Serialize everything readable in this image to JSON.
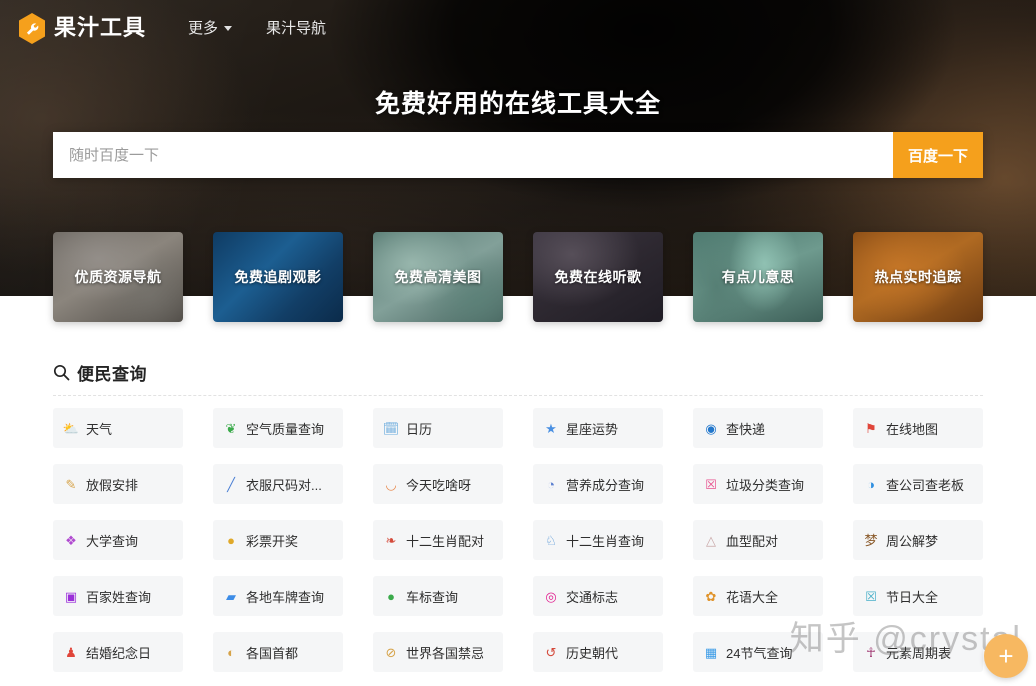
{
  "nav": {
    "brand": "果汁工具",
    "logo_icon": "wrench-hexagon-icon",
    "brand_color": "#f5a01c",
    "links": [
      {
        "label": "更多",
        "has_caret": true
      },
      {
        "label": "果汁导航",
        "has_caret": false
      }
    ]
  },
  "hero": {
    "title": "免费好用的在线工具大全",
    "search": {
      "placeholder": "随时百度一下",
      "value": "",
      "button_label": "百度一下",
      "button_color": "#f5a01c"
    }
  },
  "cards": [
    {
      "label": "优质资源导航"
    },
    {
      "label": "免费追剧观影"
    },
    {
      "label": "免费高清美图"
    },
    {
      "label": "免费在线听歌"
    },
    {
      "label": "有点儿意思"
    },
    {
      "label": "热点实时追踪"
    }
  ],
  "section": {
    "icon": "search-icon",
    "title": "便民查询",
    "items": [
      {
        "label": "天气",
        "icon": "sun-cloud-icon",
        "color": "#3c8ce7"
      },
      {
        "label": "空气质量查询",
        "icon": "leaf-icon",
        "color": "#3aaa4a"
      },
      {
        "label": "日历",
        "icon": "calendar-icon",
        "color": "#67a9dd"
      },
      {
        "label": "星座运势",
        "icon": "star-icon",
        "color": "#4a90e2"
      },
      {
        "label": "查快递",
        "icon": "delivery-truck-icon",
        "color": "#2277cc"
      },
      {
        "label": "在线地图",
        "icon": "map-pin-icon",
        "color": "#e0453a"
      },
      {
        "label": "放假安排",
        "icon": "note-pencil-icon",
        "color": "#d6a349"
      },
      {
        "label": "衣服尺码对...",
        "icon": "ruler-icon",
        "color": "#4a7fd4"
      },
      {
        "label": "今天吃啥呀",
        "icon": "noodle-bowl-icon",
        "color": "#e8874a"
      },
      {
        "label": "营养成分查询",
        "icon": "nutrition-icon",
        "color": "#5a7fd0"
      },
      {
        "label": "垃圾分类查询",
        "icon": "trash-bin-icon",
        "color": "#e8538f"
      },
      {
        "label": "查公司查老板",
        "icon": "globe-search-icon",
        "color": "#2f8fe0"
      },
      {
        "label": "大学查询",
        "icon": "diamond-icon",
        "color": "#b04ad0"
      },
      {
        "label": "彩票开奖",
        "icon": "lottery-coin-icon",
        "color": "#e0a92a"
      },
      {
        "label": "十二生肖配对",
        "icon": "rooster-icon",
        "color": "#d44a3a"
      },
      {
        "label": "十二生肖查询",
        "icon": "horse-icon",
        "color": "#4a8fd4"
      },
      {
        "label": "血型配对",
        "icon": "blood-drop-icon",
        "color": "#c9a8a8"
      },
      {
        "label": "周公解梦",
        "icon": "dream-char-icon",
        "color": "#8a5a2a"
      },
      {
        "label": "百家姓查询",
        "icon": "surname-book-icon",
        "color": "#9b30d9"
      },
      {
        "label": "各地车牌查询",
        "icon": "car-icon",
        "color": "#3c8ce7"
      },
      {
        "label": "车标查询",
        "icon": "car-badge-icon",
        "color": "#3aaa4a"
      },
      {
        "label": "交通标志",
        "icon": "traffic-light-icon",
        "color": "#e01f8f"
      },
      {
        "label": "花语大全",
        "icon": "sunflower-icon",
        "color": "#e0932a"
      },
      {
        "label": "节日大全",
        "icon": "gift-icon",
        "color": "#4ab0c9"
      },
      {
        "label": "结婚纪念日",
        "icon": "couple-icon",
        "color": "#e0453a"
      },
      {
        "label": "各国首都",
        "icon": "world-globe-icon",
        "color": "#d6a349"
      },
      {
        "label": "世界各国禁忌",
        "icon": "prohibition-icon",
        "color": "#d6a349"
      },
      {
        "label": "历史朝代",
        "icon": "history-clock-icon",
        "color": "#d4493a"
      },
      {
        "label": "24节气查询",
        "icon": "calendar-date-icon",
        "color": "#3c9ce7"
      },
      {
        "label": "元素周期表",
        "icon": "molecule-icon",
        "color": "#9b2d6a"
      }
    ]
  },
  "overlay": {
    "watermark": "知乎 @crystal",
    "fab_icon": "plus-icon",
    "fab_label": "+",
    "fab_color": "#f7b861"
  }
}
